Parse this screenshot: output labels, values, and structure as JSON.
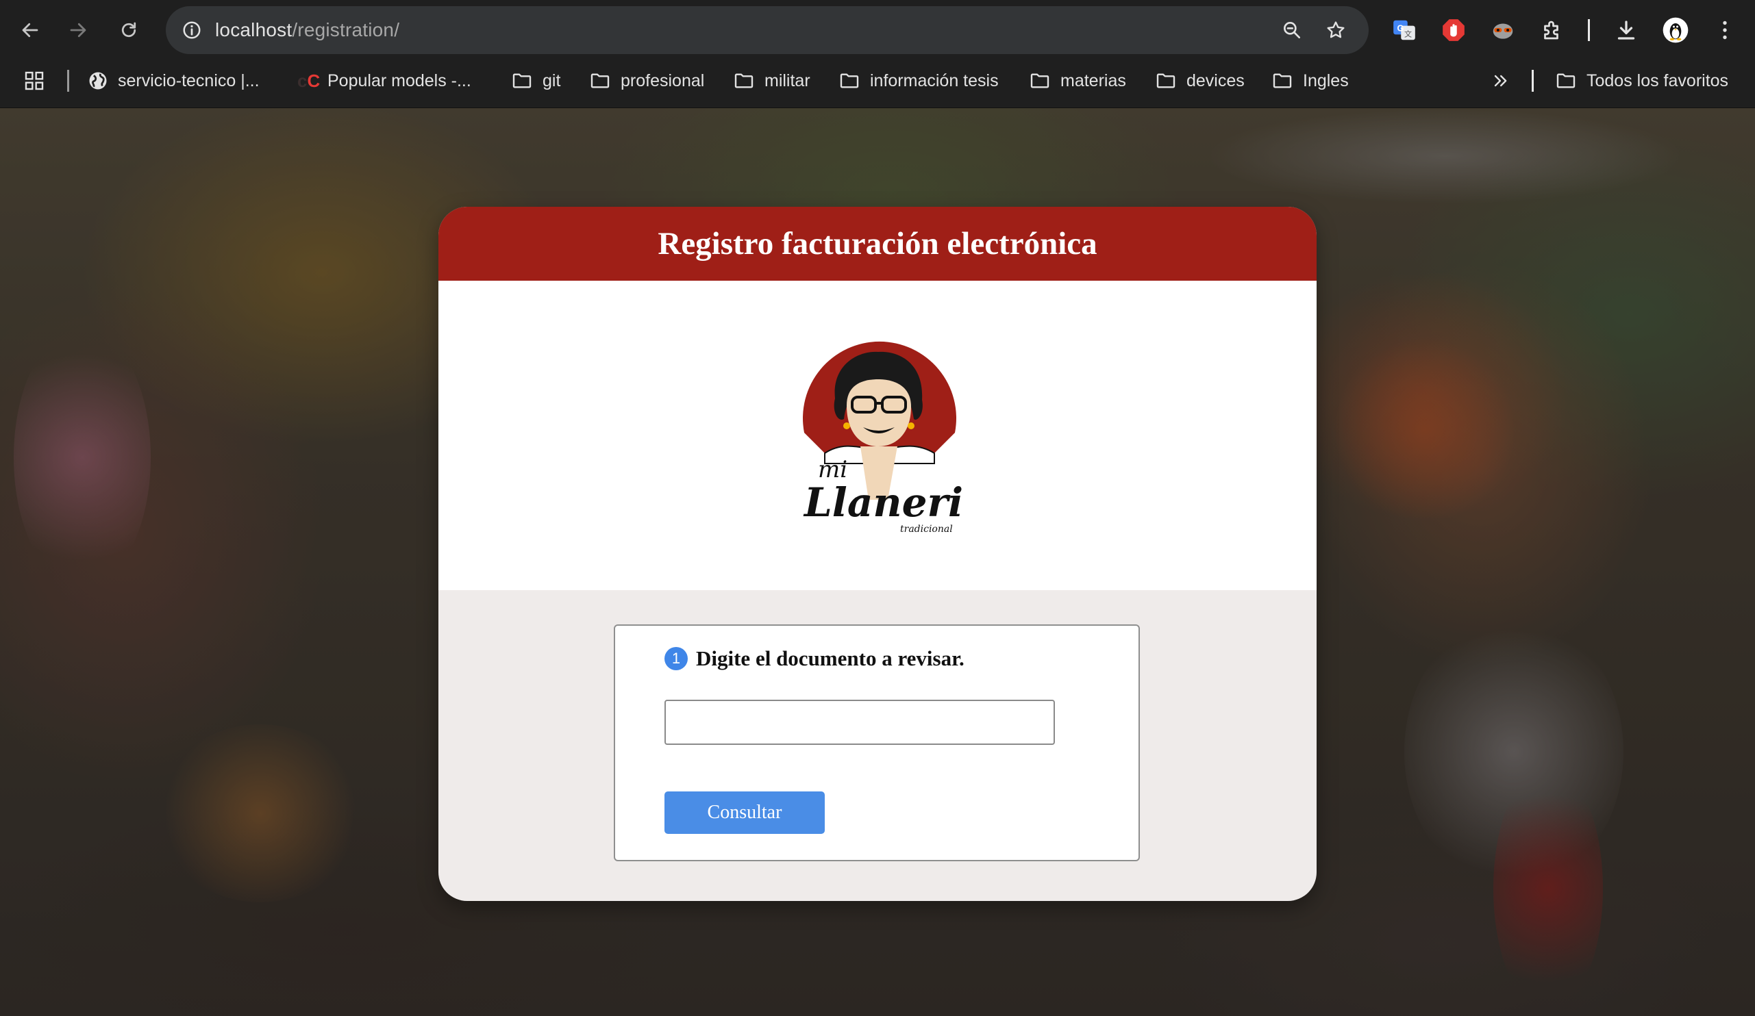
{
  "browser": {
    "url_host": "localhost",
    "url_path": "/registration/",
    "bookmarks": [
      {
        "label": "servicio-tecnico |...",
        "icon": "globe-icon"
      },
      {
        "label": "Popular models -...",
        "icon": "cc-logo-icon"
      },
      {
        "label": "git",
        "icon": "folder-icon"
      },
      {
        "label": "profesional",
        "icon": "folder-icon"
      },
      {
        "label": "militar",
        "icon": "folder-icon"
      },
      {
        "label": "información tesis",
        "icon": "folder-icon"
      },
      {
        "label": "materias",
        "icon": "folder-icon"
      },
      {
        "label": "devices",
        "icon": "folder-icon"
      },
      {
        "label": "Ingles",
        "icon": "folder-icon"
      }
    ],
    "all_bookmarks_label": "Todos los favoritos",
    "favicon_cc_text": "C"
  },
  "page": {
    "title": "Registro facturación electrónica",
    "logo_alt_text": "mi Llanerita tradicional",
    "form": {
      "step_number": "1",
      "step_label": "Digite el documento a revisar.",
      "document_value": "",
      "submit_label": "Consultar"
    }
  },
  "colors": {
    "header_red": "#9f1f17",
    "button_blue": "#4a8de6",
    "step_badge_blue": "#3f86e8",
    "chrome_dark": "#1f1f1f"
  }
}
